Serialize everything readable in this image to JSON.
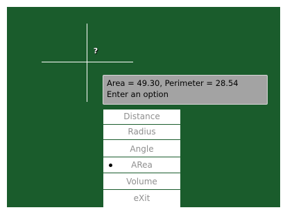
{
  "cursor": {
    "icon": "question-mark-icon",
    "glyph": "?"
  },
  "tooltip": {
    "measurement": "Area = 49.30, Perimeter = 28.54",
    "prompt": "Enter an option"
  },
  "option_menu": {
    "items": [
      {
        "label": "Distance",
        "selected": false
      },
      {
        "label": "Radius",
        "selected": false
      },
      {
        "label": "Angle",
        "selected": false
      },
      {
        "label": "ARea",
        "selected": true
      },
      {
        "label": "Volume",
        "selected": false
      },
      {
        "label": "eXit",
        "selected": false
      }
    ]
  },
  "colors": {
    "canvas_background": "#1a5c2c",
    "tooltip_background": "#a3a3a3",
    "menu_text": "#8f8f8f"
  }
}
